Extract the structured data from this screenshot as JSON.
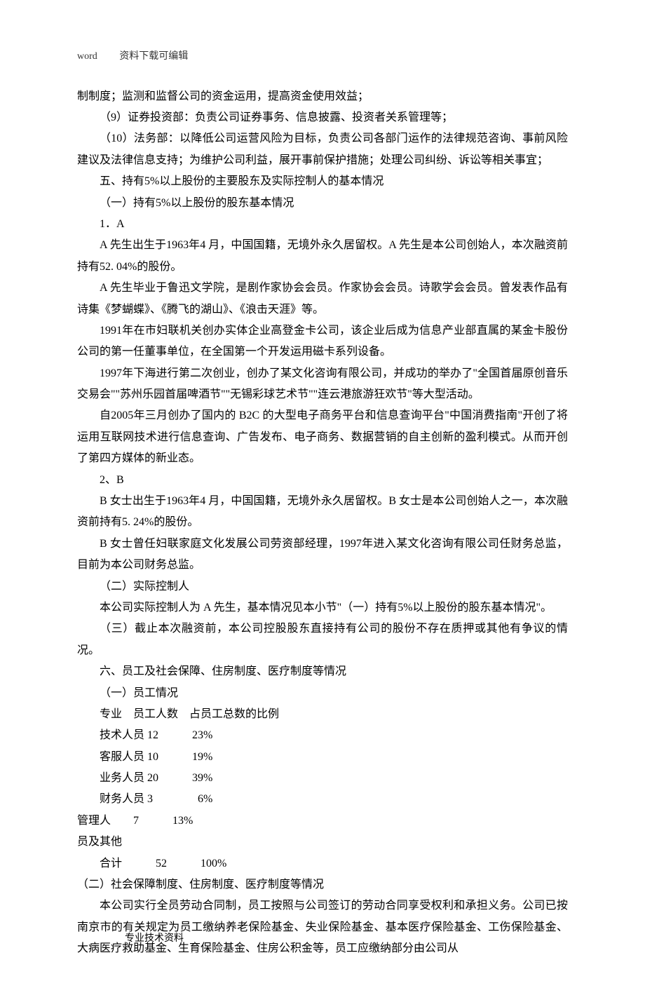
{
  "header": {
    "left": "word",
    "right": "资料下载可编辑"
  },
  "body": {
    "p1": "制制度；监测和监督公司的资金运用，提高资金使用效益；",
    "p2": "（9）证券投资部：负责公司证券事务、信息披露、投资者关系管理等；",
    "p3": "（10）法务部：以降低公司运营风险为目标，负责公司各部门运作的法律规范咨询、事前风险建议及法律信息支持；为维护公司利益，展开事前保护措施；处理公司纠纷、诉讼等相关事宜；",
    "p4": "五、持有5%以上股份的主要股东及实际控制人的基本情况",
    "p5": "（一）持有5%以上股份的股东基本情况",
    "p6": "1．A",
    "p7": "A 先生出生于1963年4  月，中国国籍，无境外永久居留权。A 先生是本公司创始人，本次融资前持有52. 04%的股份。",
    "p8": "A 先生毕业于鲁迅文学院，是剧作家协会会员。作家协会会员。诗歌学会会员。曾发表作品有诗集《梦蝴蝶》、《腾飞的湖山》、《浪击天涯》等。",
    "p9": "1991年在市妇联机关创办实体企业高登金卡公司，该企业后成为信息产业部直属的某金卡股份公司的第一任董事单位，在全国第一个开发运用磁卡系列设备。",
    "p10": "1997年下海进行第二次创业，创办了某文化咨询有限公司，并成功的举办了\"全国首届原创音乐交易会\"\"苏州乐园首届啤酒节\"\"无锡彩球艺术节\"\"连云港旅游狂欢节\"等大型活动。",
    "p11": "自2005年三月创办了国内的 B2C 的大型电子商务平台和信息查询平台\"中国消费指南\"开创了将运用互联网技术进行信息查询、广告发布、电子商务、数据营销的自主创新的盈利模式。从而开创了第四方媒体的新业态。",
    "p12": "2、B",
    "p13": "B 女士出生于1963年4  月，中国国籍，无境外永久居留权。B 女士是本公司创始人之一，本次融资前持有5.  24%的股份。",
    "p14": "B 女士曾任妇联家庭文化发展公司劳资部经理，1997年进入某文化咨询有限公司任财务总监，目前为本公司财务总监。",
    "p15": "（二）实际控制人",
    "p16": "本公司实际控制人为 A 先生，基本情况见本小节\"（一）持有5%以上股份的股东基本情况\"。",
    "p17": "（三）截止本次融资前，本公司控股股东直接持有公司的股份不存在质押或其他有争议的情况。",
    "p18": "六、员工及社会保障、住房制度、医疗制度等情况",
    "p19": "（一）员工情况",
    "p20": "专业　员工人数　占员工总数的比例",
    "p21": "技术人员 12　　　23%",
    "p22": "客服人员 10　　　19%",
    "p23": "业务人员 20　　　39%",
    "p24": "财务人员 3　　　　6%",
    "p25": "管理人　　7　　　13%",
    "p26": "员及其他",
    "p27": "合计　　　52　　　100%",
    "p28": "（二）社会保障制度、住房制度、医疗制度等情况",
    "p29": "本公司实行全员劳动合同制，员工按照与公司签订的劳动合同享受权利和承担义务。公司已按南京市的有关规定为员工缴纳养老保险基金、失业保险基金、基本医疗保险基金、工伤保险基金、大病医疗救助基金、生育保险基金、住房公积金等，员工应缴纳部分由公司从"
  },
  "footer": "专业技术资料"
}
